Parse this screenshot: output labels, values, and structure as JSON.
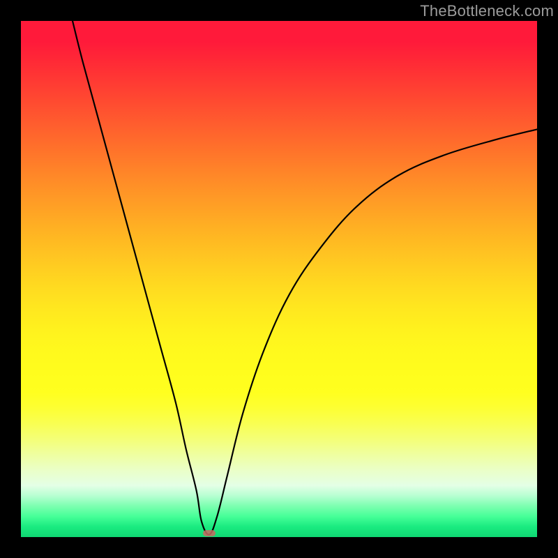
{
  "watermark": "TheBottleneck.com",
  "colors": {
    "frame": "#000000",
    "gradient_top": "#ff1a3a",
    "gradient_mid": "#ffdc20",
    "gradient_bottom": "#0fd873",
    "curve": "#000000",
    "vertex_marker": "#c76b62"
  },
  "chart_data": {
    "type": "line",
    "title": "",
    "xlabel": "",
    "ylabel": "",
    "xlim": [
      0,
      100
    ],
    "ylim": [
      0,
      100
    ],
    "grid": false,
    "legend": false,
    "series": [
      {
        "name": "curve",
        "x": [
          10,
          12,
          15,
          18,
          21,
          24,
          27,
          30,
          32,
          34,
          35,
          36.5,
          38,
          40,
          43,
          47,
          52,
          58,
          65,
          73,
          82,
          92,
          100
        ],
        "y": [
          100,
          92,
          81,
          70,
          59,
          48,
          37,
          26,
          17,
          9,
          3,
          0.5,
          4,
          12,
          24,
          36,
          47,
          56,
          64,
          70,
          74,
          77,
          79
        ],
        "note": "V-shaped curve; x≈36.5 is the minimum near y≈0.5. Values estimated from pixel positions since no axis ticks are shown."
      }
    ],
    "vertex": {
      "x": 36.5,
      "y": 0.5
    }
  }
}
